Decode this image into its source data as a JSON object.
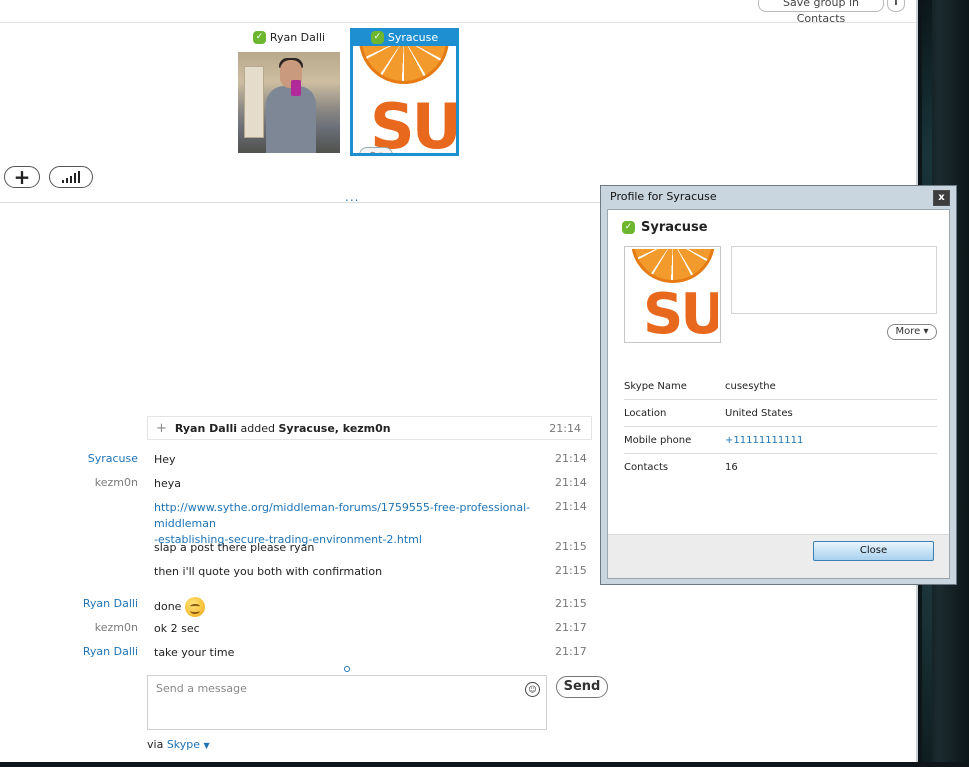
{
  "header": {
    "save_group_label": "Save group in Contacts",
    "info_label": "i"
  },
  "participants": [
    {
      "name": "Ryan Dalli",
      "status": "online"
    },
    {
      "name": "Syracuse",
      "status": "online",
      "selected": true,
      "avatar_text": "SU"
    }
  ],
  "call_controls": {
    "add_label": "+",
    "more_dots": "..."
  },
  "conversation": {
    "system_message": {
      "actor": "Ryan Dalli",
      "verb": "added",
      "targets": "Syracuse, kezm0n",
      "time": "21:14"
    },
    "messages": [
      {
        "sender": "Syracuse",
        "text": "Hey",
        "time": "21:14"
      },
      {
        "sender": "kezm0n",
        "text": "heya",
        "time": "21:14"
      },
      {
        "sender": "",
        "link_line1": "http://www.sythe.org/middleman-forums/1759555-free-professional-middleman",
        "link_line2": "-establishing-secure-trading-environment-2.html",
        "time": "21:14"
      },
      {
        "sender": "",
        "text": "slap a post there please ryan",
        "time": "21:15"
      },
      {
        "sender": "",
        "text": "then i'll quote you both with confirmation",
        "time": "21:15"
      },
      {
        "sender": "Ryan Dalli",
        "text": "done",
        "time": "21:15",
        "emoticon": "smile-icon"
      },
      {
        "sender": "kezm0n",
        "text": "ok 2 sec",
        "time": "21:17"
      },
      {
        "sender": "Ryan Dalli",
        "text": "take your time",
        "time": "21:17"
      }
    ]
  },
  "composer": {
    "placeholder": "Send a message",
    "send_label": "Send",
    "via_prefix": "via",
    "via_service": "Skype"
  },
  "profile_dialog": {
    "title": "Profile for Syracuse",
    "close_x": "x",
    "display_name": "Syracuse",
    "avatar_text": "SU",
    "more_label": "More",
    "fields": [
      {
        "key": "Skype Name",
        "value": "cusesythe"
      },
      {
        "key": "Location",
        "value": "United States"
      },
      {
        "key": "Mobile phone",
        "value": "+11111111111"
      },
      {
        "key": "Contacts",
        "value": "16"
      }
    ],
    "close_button_label": "Close"
  },
  "colors": {
    "accent_blue": "#1e90d2",
    "link_blue": "#1e73b5",
    "online_green": "#6cb72f",
    "su_orange": "#e8681d"
  }
}
